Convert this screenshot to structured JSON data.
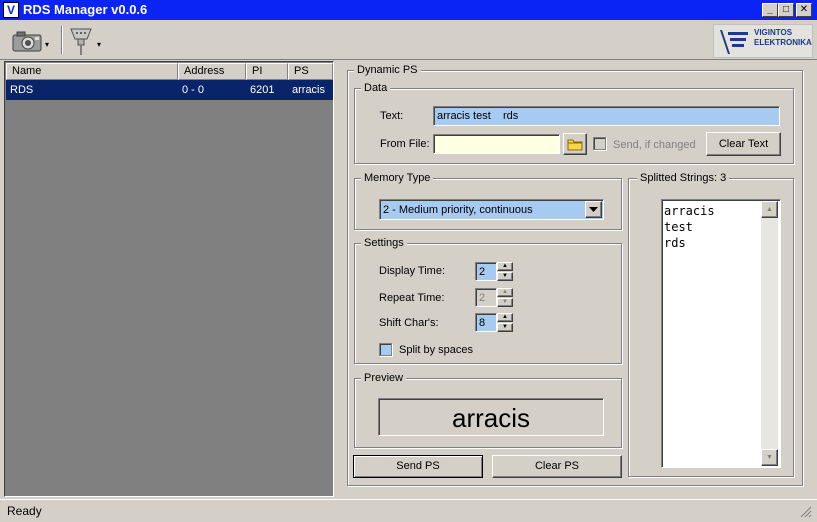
{
  "window": {
    "title": "RDS Manager v0.0.6",
    "icon_letter": "V",
    "min_glyph": "_",
    "max_glyph": "□",
    "close_glyph": "✕"
  },
  "toolbar": {
    "camera_icon": "camera-icon",
    "connector_icon": "serial-connector-icon",
    "dropdown_glyph": "▾"
  },
  "logo": {
    "line1": "VIGINTOS",
    "line2": "ELEKTRONIKA"
  },
  "list": {
    "columns": [
      "Name",
      "Address",
      "PI",
      "PS"
    ],
    "rows": [
      {
        "name": "RDS",
        "address": "0 - 0",
        "pi": "6201",
        "ps": "arracis"
      }
    ]
  },
  "dynamic_ps": {
    "title": "Dynamic PS",
    "data": {
      "title": "Data",
      "text_label": "Text:",
      "text_value": "arracis test    rds",
      "from_file_label": "From File:",
      "from_file_value": "",
      "send_if_changed_label": "Send, if changed",
      "clear_text_label": "Clear Text"
    },
    "memory_type": {
      "title": "Memory Type",
      "selected": "2 - Medium priority, continuous"
    },
    "settings": {
      "title": "Settings",
      "display_time_label": "Display Time:",
      "display_time_value": "2",
      "repeat_time_label": "Repeat Time:",
      "repeat_time_value": "2",
      "shift_chars_label": "Shift Char's:",
      "shift_chars_value": "8",
      "split_by_spaces_label": "Split by spaces"
    },
    "preview": {
      "title": "Preview",
      "value": "arracis"
    },
    "splitted": {
      "title": "Splitted Strings: 3",
      "items": [
        "arracis",
        "test",
        "rds"
      ]
    },
    "send_ps_label": "Send PS",
    "clear_ps_label": "Clear PS"
  },
  "status": {
    "text": "Ready"
  },
  "colors": {
    "titlebar": "#0a24f5",
    "selection": "#0a246a",
    "input_highlight": "#a6caf0",
    "from_file_bg": "#ffffe1"
  }
}
